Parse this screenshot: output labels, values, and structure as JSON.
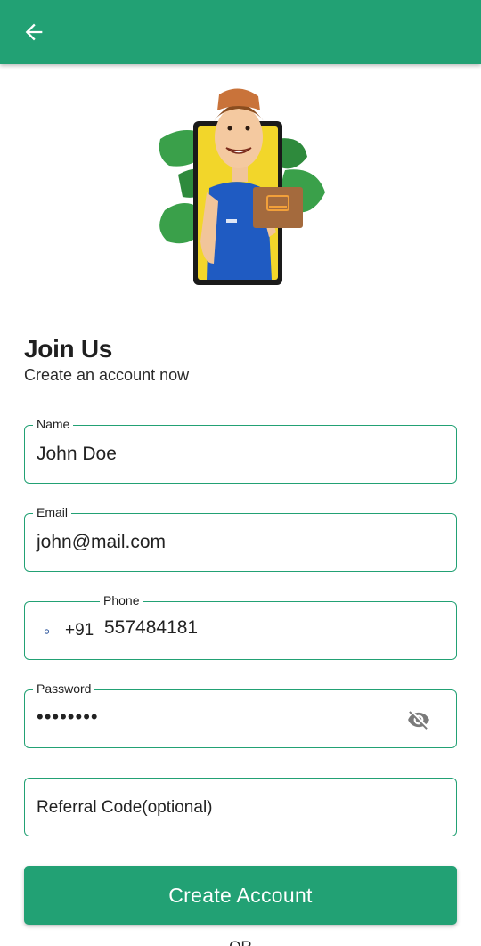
{
  "appbar": {
    "back_icon": "arrow-left-icon",
    "color": "#22a174"
  },
  "header": {
    "title": "Join Us",
    "subtitle": "Create an account now"
  },
  "form": {
    "name": {
      "label": "Name",
      "value": "John Doe"
    },
    "email": {
      "label": "Email",
      "value": "john@mail.com"
    },
    "phone": {
      "label": "Phone",
      "flag_icon": "india-flag-icon",
      "dial_code": "+91",
      "value": "557484181"
    },
    "password": {
      "label": "Password",
      "value": "••••••••",
      "toggle_icon": "eye-off-icon"
    },
    "referral": {
      "placeholder": "Referral Code(optional)"
    }
  },
  "actions": {
    "create_account_label": "Create Account",
    "or_label": "OR"
  },
  "colors": {
    "accent": "#22a174",
    "leaf": "#3aa04a",
    "phone_screen": "#f2d62a",
    "shirt": "#1f5bc2"
  }
}
